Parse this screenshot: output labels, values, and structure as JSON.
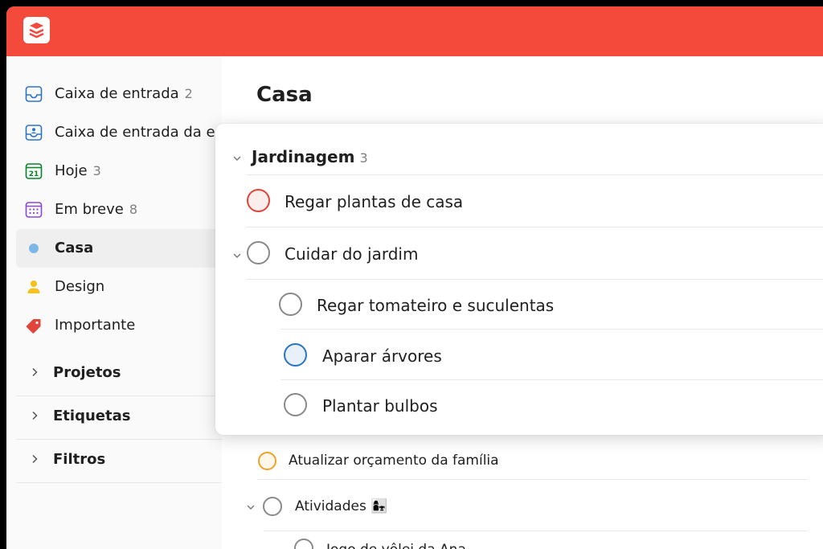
{
  "sidebar": {
    "items": [
      {
        "label": "Caixa de entrada",
        "count": "2",
        "icon": "inbox-icon",
        "color": "#2a74c8"
      },
      {
        "label": "Caixa de entrada da equipe",
        "count": "",
        "icon": "team-inbox-icon",
        "color": "#2a74c8"
      },
      {
        "label": "Hoje",
        "count": "3",
        "icon": "calendar-today-icon",
        "color": "#058527",
        "day": "21"
      },
      {
        "label": "Em breve",
        "count": "8",
        "icon": "calendar-upcoming-icon",
        "color": "#8c46d6"
      },
      {
        "label": "Casa",
        "count": "",
        "icon": "project-dot-icon",
        "color": "#7fb6e8"
      },
      {
        "label": "Design",
        "count": "",
        "icon": "person-icon",
        "color": "#f5c21b"
      },
      {
        "label": "Importante",
        "count": "",
        "icon": "tag-icon",
        "color": "#e0443a"
      }
    ],
    "groups": [
      {
        "label": "Projetos"
      },
      {
        "label": "Etiquetas"
      },
      {
        "label": "Filtros"
      }
    ]
  },
  "main": {
    "title": "Casa",
    "section": {
      "title": "Jardinagem",
      "count": "3"
    },
    "tasks": [
      {
        "label": "Regar plantas de casa"
      },
      {
        "label": "Cuidar do jardim"
      },
      {
        "label": "Regar tomateiro e suculentas"
      },
      {
        "label": "Aparar árvores"
      },
      {
        "label": "Plantar bulbos"
      }
    ],
    "background_tasks": [
      {
        "label": "Atualizar orçamento da família"
      },
      {
        "label": "Atividades"
      },
      {
        "label": "Jogo de vôlei da Ana"
      }
    ],
    "activities_emoji": "👩‍👧"
  },
  "colors": {
    "brand": "#f34a3c",
    "priority_red": "#e0443a",
    "priority_blue": "#2a74c8",
    "priority_orange": "#f0a22a"
  }
}
